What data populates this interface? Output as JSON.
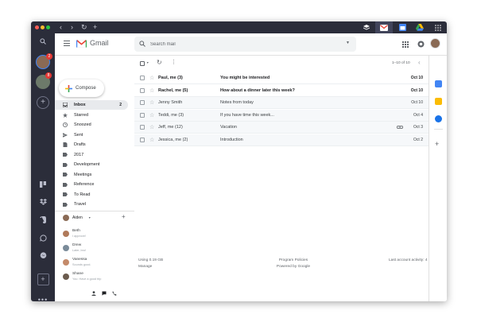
{
  "app": {
    "name": "Gmail",
    "brand_colors": {
      "red": "#EA4335",
      "blue": "#4285F4",
      "green": "#34A853",
      "yellow": "#FBBC05"
    }
  },
  "search": {
    "placeholder": "Search mail"
  },
  "compose": {
    "label": "Compose"
  },
  "nav": [
    {
      "label": "Inbox",
      "icon": "inbox-icon",
      "count": "2",
      "active": true
    },
    {
      "label": "Starred",
      "icon": "star-icon"
    },
    {
      "label": "Snoozed",
      "icon": "clock-icon"
    },
    {
      "label": "Sent",
      "icon": "send-icon"
    },
    {
      "label": "Drafts",
      "icon": "draft-icon"
    },
    {
      "label": "2017",
      "icon": "label-icon"
    },
    {
      "label": "Development",
      "icon": "label-icon"
    },
    {
      "label": "Meetings",
      "icon": "label-icon"
    },
    {
      "label": "Reference",
      "icon": "label-icon"
    },
    {
      "label": "To Read",
      "icon": "label-icon"
    },
    {
      "label": "Travel",
      "icon": "label-icon"
    }
  ],
  "hangouts": {
    "me": "Aiden",
    "contacts": [
      {
        "name": "Beth",
        "status": "I approve!",
        "color": "#b07a5a"
      },
      {
        "name": "Drew",
        "status": "Later, bro!",
        "color": "#7a8b99"
      },
      {
        "name": "Vanessa",
        "status": "Sounds good.",
        "color": "#c48a6a"
      },
      {
        "name": "Shane",
        "status": "You: Have a good trip",
        "color": "#6b5b4e"
      }
    ]
  },
  "list": {
    "pagination": "1–10 of 10",
    "emails": [
      {
        "sender": "Paul, me (3)",
        "subject": "You might be interested",
        "date": "Oct 10",
        "unread": true
      },
      {
        "sender": "Rachel, me (5)",
        "subject": "How about a dinner later this week?",
        "date": "Oct 10",
        "unread": true
      },
      {
        "sender": "Jenny Smith",
        "subject": "Notes from today",
        "date": "Oct 10",
        "unread": false
      },
      {
        "sender": "Teddi, me (3)",
        "subject": "If you have time this week...",
        "date": "Oct 4",
        "unread": false
      },
      {
        "sender": "Jeff, me (12)",
        "subject": "Vacation",
        "date": "Oct 3",
        "unread": false,
        "attachment": true
      },
      {
        "sender": "Jessica, me (2)",
        "subject": "Introduction",
        "date": "Oct 2",
        "unread": false
      }
    ]
  },
  "footer": {
    "storage": "Using 0.19 GB",
    "manage": "Manage",
    "policies": "Program Policies",
    "powered": "Powered by Google",
    "activity": "Last account activity: 4 minutes ago",
    "details": "Details"
  },
  "rail": {
    "account_badges": [
      "2",
      "8"
    ]
  }
}
